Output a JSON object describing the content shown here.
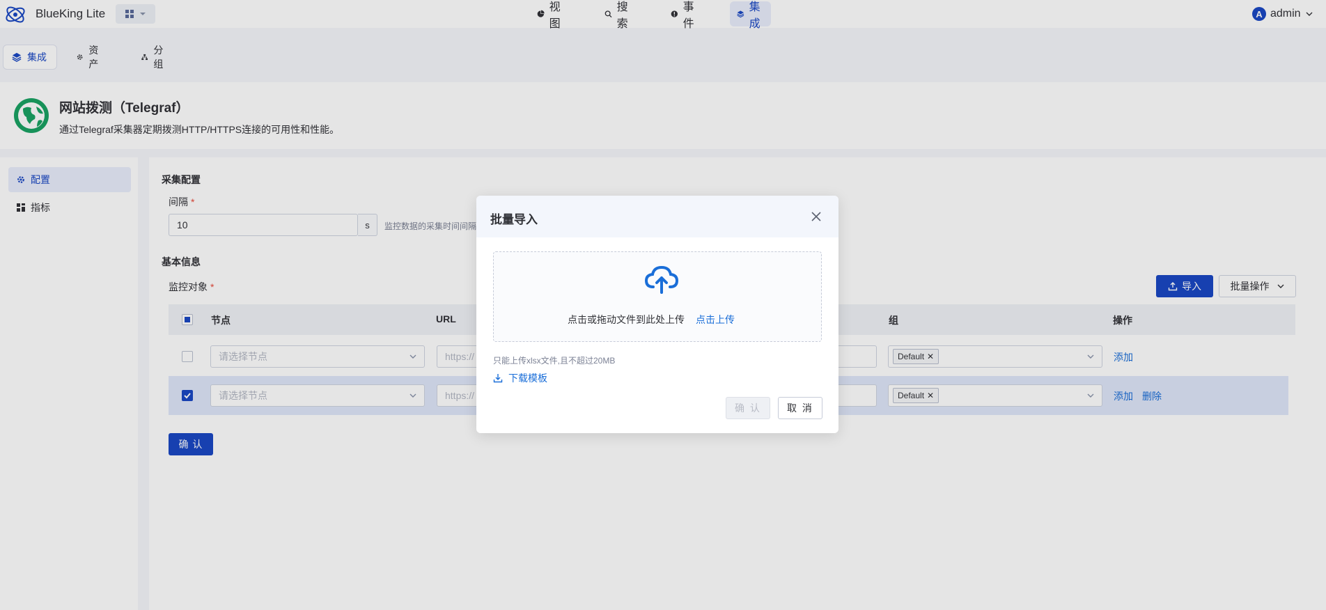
{
  "app": {
    "name": "BlueKing Lite",
    "user": "admin",
    "user_initial": "A",
    "brand_color": "#1a48c4"
  },
  "nav": [
    {
      "label": "视图",
      "icon": "pie-chart-icon"
    },
    {
      "label": "搜索",
      "icon": "search-icon"
    },
    {
      "label": "事件",
      "icon": "alert-icon"
    },
    {
      "label": "集成",
      "icon": "layers-icon",
      "active": true
    }
  ],
  "subtabs": [
    {
      "label": "集成",
      "icon": "layers-icon",
      "active": true
    },
    {
      "label": "资产",
      "icon": "gear-icon"
    },
    {
      "label": "分组",
      "icon": "hierarchy-icon"
    }
  ],
  "plugin": {
    "title": "网站拨测（Telegraf）",
    "description": "通过Telegraf采集器定期拨测HTTP/HTTPS连接的可用性和性能。"
  },
  "sidemenu": [
    {
      "label": "配置",
      "icon": "gear-icon",
      "active": true
    },
    {
      "label": "指标",
      "icon": "grid-icon"
    }
  ],
  "config": {
    "section_title": "采集配置",
    "interval_label": "间隔",
    "interval_value": "10",
    "interval_unit": "s",
    "interval_hint": "监控数据的采集时间间隔"
  },
  "basic": {
    "section_title": "基本信息",
    "target_label": "监控对象",
    "import_label": "导入",
    "batch_label": "批量操作",
    "columns": [
      "节点",
      "URL",
      "组",
      "操作"
    ],
    "rows": [
      {
        "node_placeholder": "请选择节点",
        "url_placeholder": "https://",
        "group_tag": "Default",
        "actions": [
          "添加"
        ],
        "checked": false
      },
      {
        "node_placeholder": "请选择节点",
        "url_placeholder": "https://",
        "group_tag": "Default",
        "actions": [
          "添加",
          "删除"
        ],
        "checked": true
      }
    ],
    "confirm_label": "确 认"
  },
  "modal": {
    "title": "批量导入",
    "drop_text": "点击或拖动文件到此处上传",
    "drop_link": "点击上传",
    "hint": "只能上传xlsx文件,且不超过20MB",
    "download_label": "下载模板",
    "confirm_label": "确 认",
    "cancel_label": "取 消"
  }
}
